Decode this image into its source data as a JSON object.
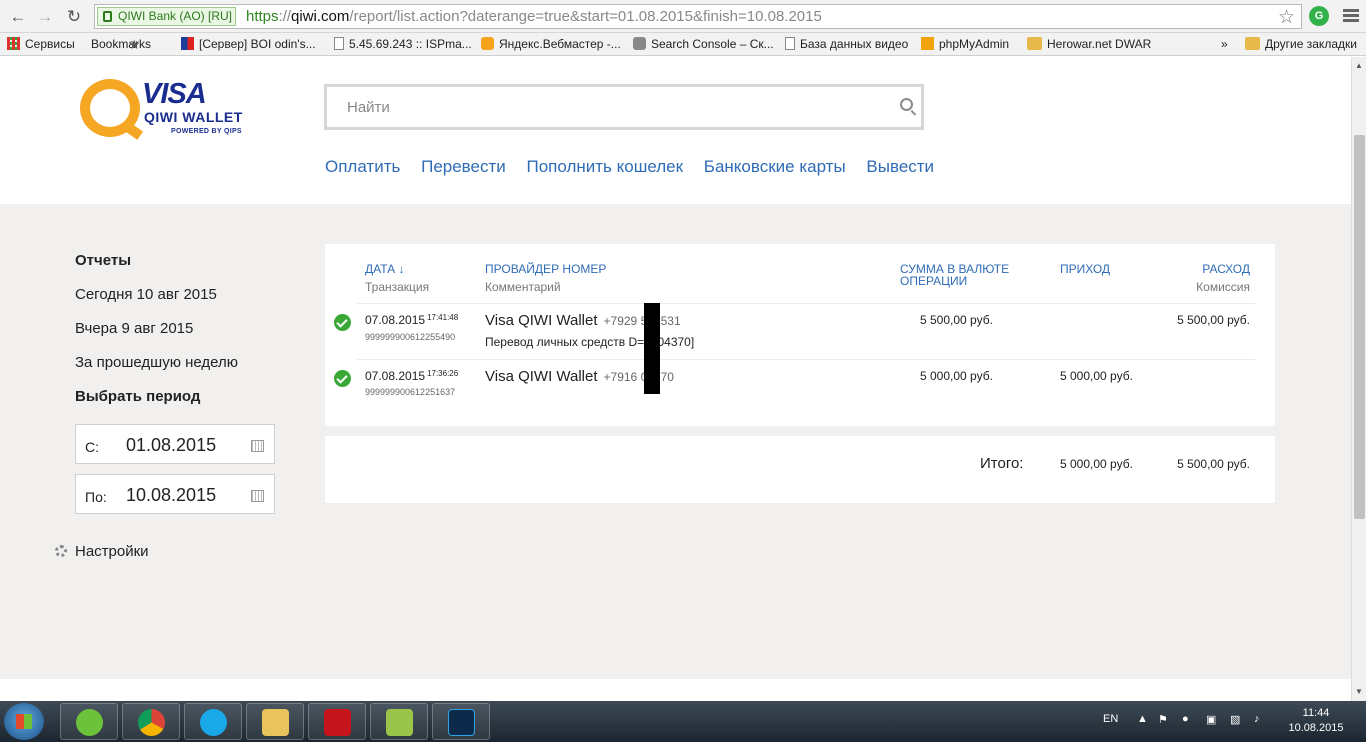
{
  "browser": {
    "ev_label": "QIWI Bank (AO) [RU]",
    "url_scheme": "https",
    "url_sep": "://",
    "url_host": "qiwi.com",
    "url_path": "/report/list.action?daterange=true&start=01.08.2015&finish=10.08.2015",
    "bookmarks": [
      {
        "label": "Сервисы",
        "icon": "apps-grid-icon"
      },
      {
        "label": "Bookmarks",
        "icon": "star-icon"
      },
      {
        "label": "[Сервер] BOI odin's...",
        "icon": "flag-icon"
      },
      {
        "label": "5.45.69.243 :: ISPma...",
        "icon": "page-icon"
      },
      {
        "label": "Яндекс.Вебмастер -...",
        "icon": "yandex-icon"
      },
      {
        "label": "Search Console – Ск...",
        "icon": "search-console-icon"
      },
      {
        "label": "База данных видео",
        "icon": "page-icon"
      },
      {
        "label": "phpMyAdmin",
        "icon": "pma-icon"
      },
      {
        "label": "Herowar.net DWAR",
        "icon": "folder-icon"
      }
    ],
    "bookmarks_overflow": "»",
    "other_bookmarks": "Другие закладки"
  },
  "header": {
    "logo_visa": "VISA",
    "logo_wallet": "QIWI WALLET",
    "logo_powered": "POWERED BY QIPS",
    "search_placeholder": "Найти",
    "nav": [
      "Оплатить",
      "Перевести",
      "Пополнить кошелек",
      "Банковские карты",
      "Вывести"
    ]
  },
  "sidebar": {
    "title": "Отчеты",
    "today": "Сегодня 10 авг 2015",
    "yesterday": "Вчера 9 авг 2015",
    "last_week": "За прошедшую неделю",
    "choose_period": "Выбрать период",
    "from_label": "С:",
    "from_value": "01.08.2015",
    "to_label": "По:",
    "to_value": "10.08.2015",
    "settings": "Настройки"
  },
  "report": {
    "columns": {
      "date": "ДАТА ↓",
      "date_sub": "Транзакция",
      "provider": "ПРОВАЙДЕР НОМЕР",
      "provider_sub": "Комментарий",
      "amount_line1": "СУММА В ВАЛЮТЕ",
      "amount_line2": "ОПЕРАЦИИ",
      "income": "ПРИХОД",
      "expense": "РАСХОД",
      "expense_sub": "Комиссия"
    },
    "rows": [
      {
        "date": "07.08.2015",
        "time": "17:41:48",
        "txn": "9999999006122554​90",
        "provider": "Visa QIWI Wallet",
        "number": "+7929 503531",
        "comment": "Перевод личных средств   D=2804370]",
        "amount": "5 500,00 руб.",
        "income": "",
        "expense": "5 500,00 руб."
      },
      {
        "date": "07.08.2015",
        "time": "17:36:26",
        "txn": "999999900612251637",
        "provider": "Visa QIWI Wallet",
        "number": "+7916 04170",
        "comment": "",
        "amount": "5 000,00 руб.",
        "income": "5 000,00 руб.",
        "expense": ""
      }
    ],
    "total_label": "Итого:",
    "total_income": "5 000,00 руб.",
    "total_expense": "5 500,00 руб."
  },
  "taskbar": {
    "lang": "EN",
    "time": "11:44",
    "date": "10.08.2015"
  },
  "colors": {
    "link": "#2f6cb6",
    "accent_orange": "#f5a623",
    "brand_blue": "#1a2d8f",
    "ok_green": "#39a935",
    "page_bg": "#f1f0ee"
  }
}
